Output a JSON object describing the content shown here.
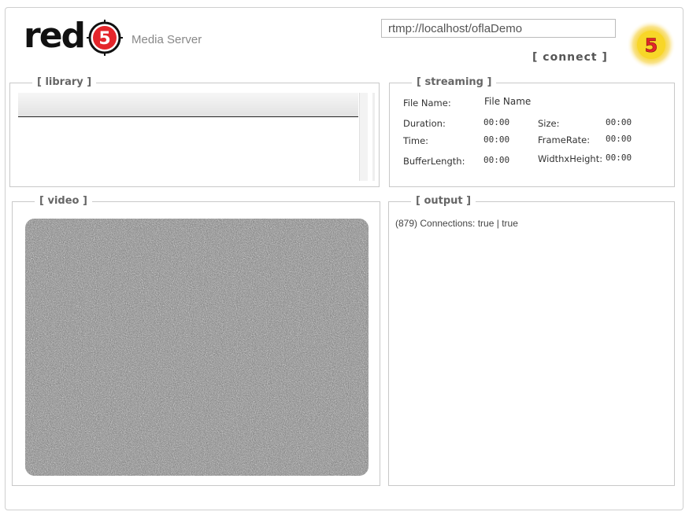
{
  "header": {
    "logo_text": "red",
    "logo_digit": "5",
    "logo_subtitle": "Media Server",
    "url_value": "rtmp://localhost/oflaDemo",
    "connect_label": "[ connect ]",
    "badge_digit": "5"
  },
  "library": {
    "title": "[ library ]"
  },
  "streaming": {
    "title": "[ streaming ]",
    "file_name_label": "File Name:",
    "file_name_value": "File Name",
    "duration_label": "Duration:",
    "duration_value": "00:00",
    "size_label": "Size:",
    "size_value": "00:00",
    "time_label": "Time:",
    "time_value": "00:00",
    "framerate_label": "FrameRate:",
    "framerate_value": "00:00",
    "bufferlength_label": "BufferLength:",
    "bufferlength_value": "00:00",
    "widthheight_label": "WidthxHeight:",
    "widthheight_value": "00:00"
  },
  "video": {
    "title": "[ video ]"
  },
  "output": {
    "title": "[ output ]",
    "lines": [
      "(879) Connections: true | true"
    ]
  },
  "colors": {
    "brand_red": "#e4262b",
    "badge_yellow": "#f6d21a",
    "text_gray": "#666666"
  }
}
